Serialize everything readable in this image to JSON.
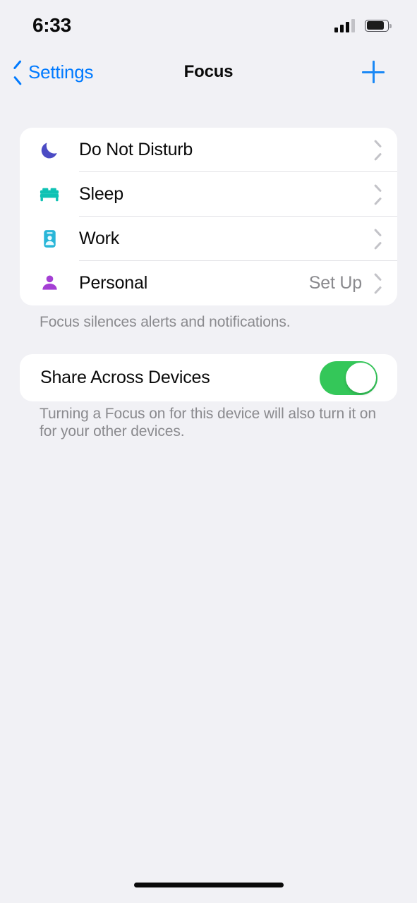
{
  "status_bar": {
    "time": "6:33",
    "signal_icon": "cellular-signal-icon",
    "signal_bars_filled": 3,
    "signal_bars_total": 4,
    "battery_icon": "battery-icon",
    "battery_level_percent": 82
  },
  "nav": {
    "back_label": "Settings",
    "back_icon": "chevron-left-icon",
    "title": "Focus",
    "add_icon": "plus-icon"
  },
  "focus_list": {
    "items": [
      {
        "label": "Do Not Disturb",
        "icon": "moon-icon",
        "icon_color": "#4b4bc4",
        "value": ""
      },
      {
        "label": "Sleep",
        "icon": "bed-icon",
        "icon_color": "#0ec2b4",
        "value": ""
      },
      {
        "label": "Work",
        "icon": "id-badge-icon",
        "icon_color": "#29b6d8",
        "value": ""
      },
      {
        "label": "Personal",
        "icon": "person-icon",
        "icon_color": "#a43fd4",
        "value": "Set Up"
      }
    ],
    "footer": "Focus silences alerts and notifications."
  },
  "share_section": {
    "label": "Share Across Devices",
    "toggle_on": true,
    "toggle_on_color": "#34c759",
    "footer": "Turning a Focus on for this device will also turn it on for your other devices."
  },
  "theme": {
    "background": "#f1f1f5",
    "card_background": "#ffffff",
    "accent_blue": "#007aff",
    "secondary_text": "#8a8a8e"
  },
  "home_indicator": "home-indicator"
}
